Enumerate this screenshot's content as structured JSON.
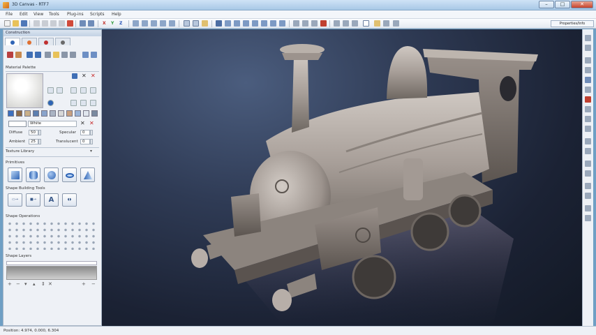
{
  "window": {
    "title": "3D Canvas - RTF7",
    "minimize_glyph": "–",
    "maximize_glyph": "□",
    "close_glyph": "✕"
  },
  "menu": {
    "items": [
      "File",
      "Edit",
      "View",
      "Tools",
      "Plug-ins",
      "Scripts",
      "Help"
    ]
  },
  "toolbar": {
    "axis_x": "X",
    "axis_y": "Y",
    "axis_z": "Z",
    "properties_label": "Properties/Info"
  },
  "left_panel": {
    "title": "Construction",
    "tab_icons": [
      "construction-tab-icon",
      "materials-tab-icon",
      "texture-tab-icon",
      "tools-tab-icon"
    ],
    "material_palette_label": "Material Palette",
    "texture_dropdown_value": "White",
    "diffuse_label": "Diffuse",
    "diffuse_value": "50",
    "ambient_label": "Ambient",
    "ambient_value": "25",
    "specular_label": "Specular",
    "specular_value": "0",
    "translucent_label": "Translucent",
    "translucent_value": "0",
    "texture_library_label": "Texture Library",
    "primitives_label": "Primitives",
    "shape_building_label": "Shape Building Tools",
    "shape_ops_label": "Shape Operations",
    "shape_layers_label": "Shape Layers",
    "primitive_icons": [
      "cube-icon",
      "cylinder-icon",
      "sphere-icon",
      "torus-icon",
      "cone-icon"
    ],
    "building_tools": [
      "lathe-icon",
      "extrude-icon",
      "text-icon",
      "shape-icon"
    ]
  },
  "colors": {
    "accent": "#2f64b5",
    "viewport_bg": "#1b2234",
    "model": "#a59c96",
    "close_button": "#c6432b"
  },
  "status": {
    "position_text": "Position: 4.974, 0.000, 6.304"
  }
}
